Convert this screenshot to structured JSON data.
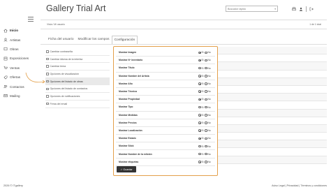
{
  "app": {
    "title": "Gallery Trial Art"
  },
  "search": {
    "placeholder": "Buscador rápido"
  },
  "breadcrumb": "Vista  /  Mi usuario",
  "page_count": "1 de 1 total",
  "sidebar": {
    "items": [
      {
        "label": "Inicio",
        "icon": "home-icon",
        "active": true
      },
      {
        "label": "Artistas",
        "icon": "artists-icon",
        "active": false
      },
      {
        "label": "Obras",
        "icon": "artworks-icon",
        "active": false
      },
      {
        "label": "Exposiciones",
        "icon": "exhibitions-icon",
        "active": false
      },
      {
        "label": "Ventas",
        "icon": "sales-icon",
        "active": false
      },
      {
        "label": "Ofertas",
        "icon": "offers-icon",
        "active": false
      },
      {
        "label": "Contactos",
        "icon": "contacts-icon",
        "active": false
      },
      {
        "label": "Mailing",
        "icon": "mailing-icon",
        "active": false
      }
    ]
  },
  "tabs": [
    {
      "label": "Ficha del usuario",
      "active": false
    },
    {
      "label": "Modificar los campos",
      "active": false
    },
    {
      "label": "Configuración",
      "active": true
    }
  ],
  "left_panel": {
    "items": [
      {
        "label": "Cambiar contraseña",
        "active": false
      },
      {
        "label": "Cambiar idioma de la interfaz",
        "active": false
      },
      {
        "label": "Cambiar tema",
        "active": false
      },
      {
        "label": "Opciones de visualización",
        "active": false
      },
      {
        "label": "Opciones del listado de obras",
        "active": true
      },
      {
        "label": "Opciones del listado de contactos",
        "active": false
      },
      {
        "label": "Opciones de notificaciones",
        "active": false
      },
      {
        "label": "Firma del email",
        "active": false
      }
    ]
  },
  "options": {
    "yes_label": "Sí",
    "no_label": "No",
    "rows": [
      {
        "label": "Mostrar Imagen",
        "value": "yes"
      },
      {
        "label": "Mostrar Nº inventario",
        "value": "yes"
      },
      {
        "label": "Mostrar Título",
        "value": "yes"
      },
      {
        "label": "Mostrar Nombre del Artista",
        "value": "yes"
      },
      {
        "label": "Mostrar Año",
        "value": "yes"
      },
      {
        "label": "Mostrar Técnica",
        "value": "yes"
      },
      {
        "label": "Mostrar Propiedad",
        "value": "yes"
      },
      {
        "label": "Mostrar Tipo",
        "value": "yes"
      },
      {
        "label": "Mostrar Medidas",
        "value": "yes"
      },
      {
        "label": "Mostrar Precios",
        "value": "yes"
      },
      {
        "label": "Mostrar Localización",
        "value": "yes"
      },
      {
        "label": "Mostrar Estado",
        "value": "yes"
      },
      {
        "label": "Mostrar Stick",
        "value": "yes"
      },
      {
        "label": "Mostrar Nombre de la edición",
        "value": "yes"
      },
      {
        "label": "Mostrar etiquetas",
        "value": "yes"
      }
    ]
  },
  "save_button": "✓ Guardar",
  "footer": {
    "left": "2026 © ITgallery",
    "right": "Aviso Legal | Privacidad | Términos y condiciones"
  },
  "colors": {
    "highlight": "#e3a04b",
    "button_bg": "#333333"
  }
}
